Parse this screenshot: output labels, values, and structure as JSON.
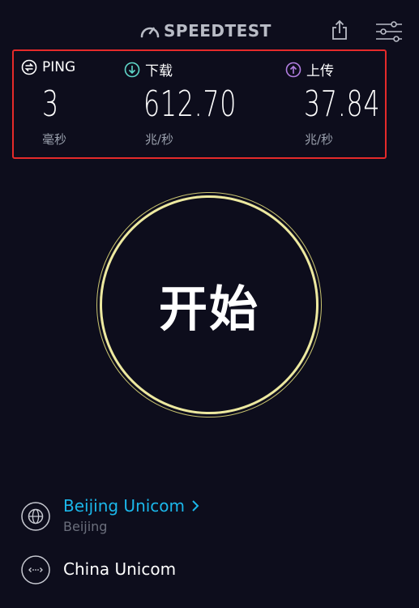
{
  "header": {
    "logo_text": "SPEEDTEST"
  },
  "metrics": {
    "ping": {
      "label": "PING",
      "value": "3",
      "unit": "毫秒"
    },
    "download": {
      "label": "下载",
      "value": "612.70",
      "unit": "兆/秒"
    },
    "upload": {
      "label": "上传",
      "value": "37.84",
      "unit": "兆/秒"
    }
  },
  "go_button": {
    "label": "开始"
  },
  "provider": {
    "name": "Beijing Unicom",
    "location": "Beijing"
  },
  "server": {
    "name": "China Unicom"
  },
  "colors": {
    "background": "#0d0d1c",
    "highlight_border": "#e52a2a",
    "go_ring": "#ede9a0",
    "ping_icon": "#ffffff",
    "download_icon": "#5fd7c9",
    "upload_icon": "#b17ee0",
    "provider_link": "#1bb7ea"
  },
  "icons": {
    "logo": "speedometer-icon",
    "share": "share-icon",
    "settings": "settings-sliders-icon",
    "ping": "ping-icon",
    "download": "download-icon",
    "upload": "upload-icon",
    "provider": "globe-icon",
    "server": "server-dots-icon"
  }
}
